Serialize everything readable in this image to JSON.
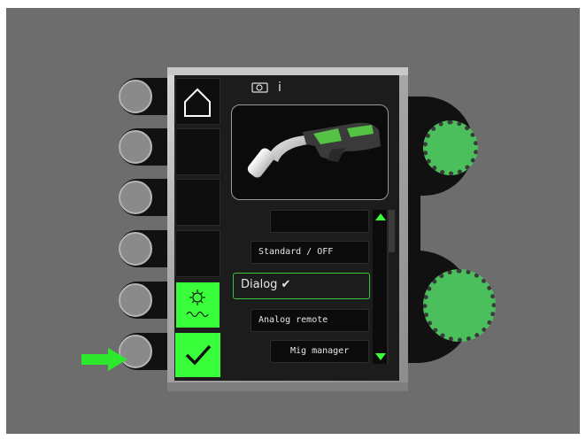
{
  "header": {
    "info_label": "i"
  },
  "icons": {
    "home": "home-icon",
    "torch_info": "torch-info-icon",
    "settings_waves": "wire-feed-settings-icon",
    "confirm": "checkmark-icon",
    "arrow": "arrow-right-icon"
  },
  "menu": {
    "items": [
      {
        "label": ""
      },
      {
        "label": "Standard / OFF"
      },
      {
        "label": "Dialog ✔"
      },
      {
        "label": "Analog remote"
      },
      {
        "label": "Mig manager"
      }
    ],
    "selected_index": 2
  },
  "colors": {
    "accent_green": "#39ff3a",
    "knob_green": "#4bbf5b",
    "arrow_green": "#2ee82e"
  }
}
